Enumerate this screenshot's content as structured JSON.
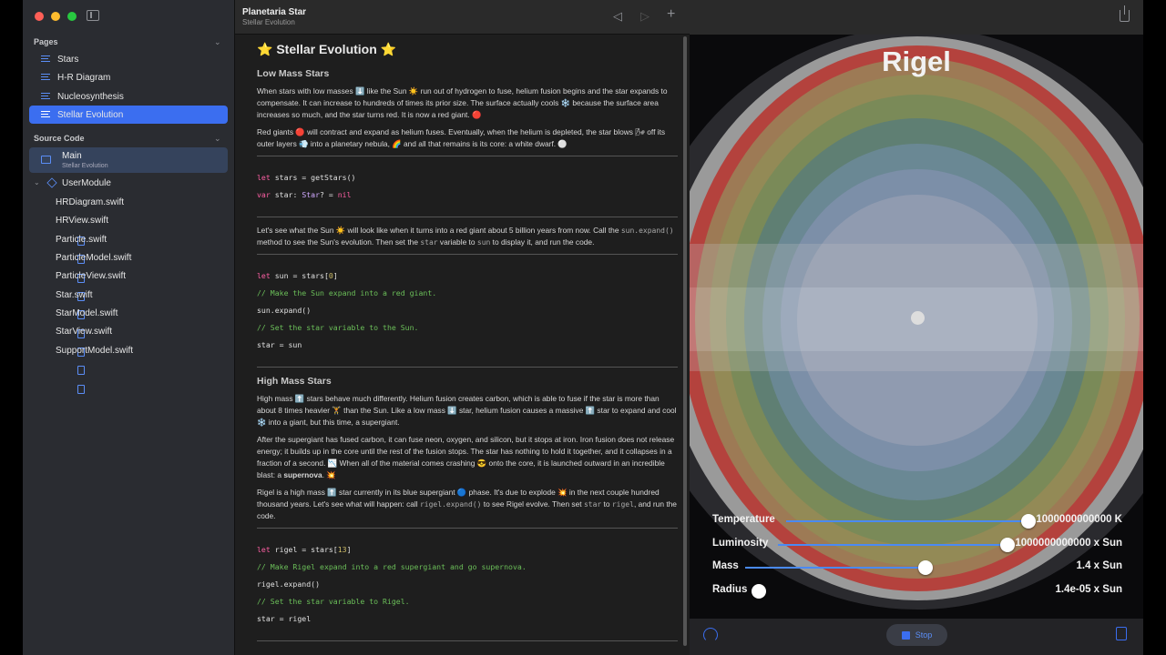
{
  "app": {
    "title": "Planetaria Star",
    "subtitle": "Stellar Evolution"
  },
  "sidebar": {
    "pages_header": "Pages",
    "pages": [
      {
        "label": "Stars"
      },
      {
        "label": "H-R Diagram"
      },
      {
        "label": "Nucleosynthesis"
      },
      {
        "label": "Stellar Evolution",
        "selected": true
      }
    ],
    "source_header": "Source Code",
    "main": {
      "label": "Main",
      "sublabel": "Stellar Evolution"
    },
    "module": {
      "label": "UserModule"
    },
    "files": [
      "HRDiagram.swift",
      "HRView.swift",
      "Particle.swift",
      "ParticleModel.swift",
      "ParticleView.swift",
      "Star.swift",
      "StarModel.swift",
      "StarView.swift",
      "SupportModel.swift"
    ]
  },
  "doc": {
    "title": "⭐ Stellar Evolution ⭐",
    "low_heading": "Low Mass Stars",
    "p1": "When stars with low masses ⬇️ like the Sun ☀️ run out of hydrogen to fuse, helium fusion begins and the star expands to compensate. It can increase to hundreds of times its prior size. The surface actually cools ❄️ because the surface area increases so much, and the star turns red. It is now a red giant. 🔴",
    "p2": "Red giants 🔴 will contract and expand as helium fuses. Eventually, when the helium is depleted, the star blows 🌬 off its outer layers 💨 into a planetary nebula, 🌈 and all that remains is its core: a white dwarf. ⚪",
    "code1": [
      {
        "kw": "let",
        "rest": " stars = getStars()"
      },
      {
        "kw": "var",
        "rest": " star: ",
        "ty": "Star",
        "rest2": "? = ",
        "lit": "nil"
      }
    ],
    "p3a": "Let's see what the Sun ☀️ will look like when it turns into a red giant about 5 billion years from now. Call the ",
    "p3_code1": "sun.expand()",
    "p3b": " method to see the Sun's evolution. Then set the ",
    "p3_code2": "star",
    "p3c": " variable to ",
    "p3_code3": "sun",
    "p3d": " to display it, and run the code.",
    "code2": {
      "l1_kw": "let",
      "l1_rest": " sun = stars[",
      "l1_num": "0",
      "l1_end": "]",
      "l2": "// Make the Sun expand into a red giant.",
      "l3": "sun.expand()",
      "l4": "// Set the star variable to the Sun.",
      "l5": "star = sun"
    },
    "high_heading": "High Mass Stars",
    "p4": "High mass ⬆️ stars behave much differently. Helium fusion creates carbon, which is able to fuse if the star is more than about 8 times heavier 🏋️ than the Sun. Like a low mass ⬇️ star, helium fusion causes a massive ⬆️ star to expand and cool ❄️ into a giant, but this time, a supergiant.",
    "p5a": "After the supergiant has fused carbon, it can fuse neon, oxygen, and silicon, but it stops at iron. Iron fusion does not release energy; it builds up in the core until the rest of the fusion stops. The star has nothing to hold it together, and it collapses in a fraction of a second. 📉 When all of the material comes crashing 😎 onto the core, it is launched outward in an incredible blast: a ",
    "p5_bold": "supernova",
    "p5b": ". 💥",
    "p6a": "Rigel is a high mass ⬆️ star currently in its blue supergiant 🔵 phase. It's due to explode 💥 in the next couple hundred thousand years. Let's see what will happen: call ",
    "p6_code1": "rigel.expand()",
    "p6b": " to see Rigel evolve. Then set ",
    "p6_code2": "star",
    "p6c": " to ",
    "p6_code3": "rigel",
    "p6d": ", and run the code.",
    "code3": {
      "l1_kw": "let",
      "l1_rest": " rigel = stars[",
      "l1_num": "13",
      "l1_end": "]",
      "l2": "// Make Rigel expand into a red supergiant and go supernova.",
      "l3": "rigel.expand()",
      "l4": "// Set the star variable to Rigel.",
      "l5": "star = rigel"
    }
  },
  "preview": {
    "star_name": "Rigel",
    "sliders": [
      {
        "label": "Temperature",
        "value": "1000000000000 K",
        "fraction": 1.0
      },
      {
        "label": "Luminosity",
        "value": "1000000000000 x Sun",
        "fraction": 1.0
      },
      {
        "label": "Mass",
        "value": "1.4 x Sun",
        "fraction": 0.75
      },
      {
        "label": "Radius",
        "value": "1.4e-05 x Sun",
        "fraction": 0.0
      }
    ],
    "stop_label": "Stop",
    "accent": "#3b6ef0"
  }
}
